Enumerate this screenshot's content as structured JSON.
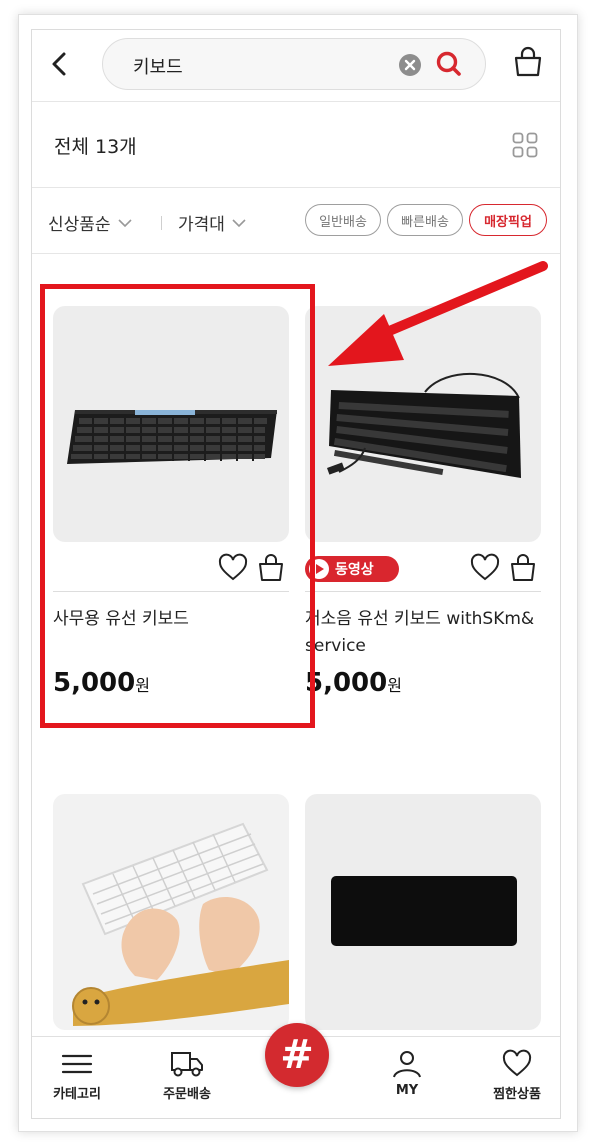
{
  "search": {
    "query": "키보드"
  },
  "results": {
    "count_label": "전체 13개"
  },
  "filters": {
    "sort_label": "신상품순",
    "price_label": "가격대",
    "chips": [
      {
        "label": "일반배송",
        "active": false
      },
      {
        "label": "빠른배송",
        "active": false
      },
      {
        "label": "매장픽업",
        "active": true
      }
    ]
  },
  "products": [
    {
      "name": "사무용 유선 키보드",
      "price": "5,000",
      "unit": "원",
      "video": false
    },
    {
      "name": "저소음 유선 키보드 withSKm&service",
      "price": "5,000",
      "unit": "원",
      "video": true,
      "video_label": "동영상"
    },
    {
      "name": "",
      "price": "",
      "unit": "",
      "video": false
    },
    {
      "name": "",
      "price": "",
      "unit": "",
      "video": false
    }
  ],
  "bottom_nav": {
    "items": [
      {
        "label": "카테고리",
        "icon": "menu-icon"
      },
      {
        "label": "주문배송",
        "icon": "truck-icon"
      },
      {
        "label": "#",
        "icon": "hash-icon"
      },
      {
        "label": "MY",
        "icon": "user-icon"
      },
      {
        "label": "찜한상품",
        "icon": "heart-icon"
      }
    ]
  },
  "colors": {
    "accent": "#d7282f",
    "thumb_bg": "#ededed",
    "highlight": "#e3161d"
  }
}
